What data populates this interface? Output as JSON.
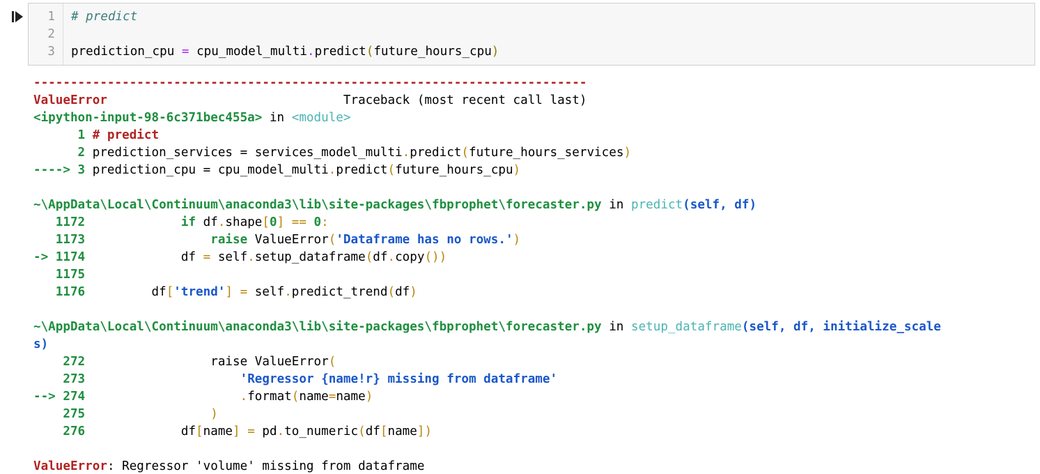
{
  "cell": {
    "line_numbers": [
      "1",
      "2",
      "3"
    ],
    "lines": {
      "l1_comment": "# predict",
      "l3_var": "prediction_cpu ",
      "l3_eq": "=",
      "l3_obj": " cpu_model_multi",
      "l3_dot": ".",
      "l3_func": "predict",
      "l3_open": "(",
      "l3_arg": "future_hours_cpu",
      "l3_close": ")"
    }
  },
  "output": {
    "dashes": "---------------------------------------------------------------------------",
    "error_name": "ValueError",
    "traceback_label": "                                Traceback (most recent call last)",
    "frame1": {
      "file": "<ipython-input-98-6c371bec455a>",
      "in": " in ",
      "func": "<module>",
      "l1_num": "      1 ",
      "l1_code": "# predict",
      "l2_num": "      2 ",
      "l2_pre": "prediction_services = services_model_multi",
      "l2_dot": ".",
      "l2_func": "predict",
      "l2_open": "(",
      "l2_arg": "future_hours_services",
      "l2_close": ")",
      "l3_arrow": "----> 3 ",
      "l3_pre": "prediction_cpu = cpu_model_multi",
      "l3_dot": ".",
      "l3_func": "predict",
      "l3_open": "(",
      "l3_arg": "future_hours_cpu",
      "l3_close": ")"
    },
    "frame2": {
      "file": "~\\AppData\\Local\\Continuum\\anaconda3\\lib\\site-packages\\fbprophet\\forecaster.py",
      "in": " in ",
      "func": "predict",
      "args": "(self, df)",
      "n1172": "   1172 ",
      "c1172_indent": "            ",
      "c1172_if": "if",
      "c1172_a": " df",
      "c1172_dot": ".",
      "c1172_b": "shape",
      "c1172_lb": "[",
      "c1172_zero": "0",
      "c1172_rb": "]",
      "c1172_c": " ",
      "c1172_eq": "==",
      "c1172_d": " ",
      "c1172_zero2": "0",
      "c1172_colon": ":",
      "n1173": "   1173 ",
      "c1173_indent": "                ",
      "c1173_raise": "raise",
      "c1173_a": " ValueError",
      "c1173_open": "(",
      "c1173_str": "'Dataframe has no rows.'",
      "c1173_close": ")",
      "n1174": "-> 1174 ",
      "c1174_indent": "            ",
      "c1174_a": "df ",
      "c1174_eq": "=",
      "c1174_b": " self",
      "c1174_dot": ".",
      "c1174_c": "setup_dataframe",
      "c1174_open": "(",
      "c1174_d": "df",
      "c1174_dot2": ".",
      "c1174_e": "copy",
      "c1174_parens": "())",
      "n1175": "   1175 ",
      "n1176": "   1176 ",
      "c1176_indent": "        ",
      "c1176_a": "df",
      "c1176_lb": "[",
      "c1176_str": "'trend'",
      "c1176_rb": "]",
      "c1176_b": " ",
      "c1176_eq": "=",
      "c1176_c": " self",
      "c1176_dot": ".",
      "c1176_d": "predict_trend",
      "c1176_open": "(",
      "c1176_e": "df",
      "c1176_close": ")"
    },
    "frame3": {
      "file": "~\\AppData\\Local\\Continuum\\anaconda3\\lib\\site-packages\\fbprophet\\forecaster.py",
      "in": " in ",
      "func": "setup_dataframe",
      "args_a": "(self, df, initialize_scale",
      "args_b": "s)",
      "n272": "    272 ",
      "c272_indent": "                ",
      "c272_a": "raise ValueError",
      "c272_open": "(",
      "n273": "    273 ",
      "c273_indent": "                    ",
      "c273_str": "'Regressor {name!r} missing from dataframe'",
      "n274": "--> 274 ",
      "c274_indent": "                    ",
      "c274_dot": ".",
      "c274_a": "format",
      "c274_open": "(",
      "c274_b": "name",
      "c274_eq": "=",
      "c274_c": "name",
      "c274_close": ")",
      "n275": "    275 ",
      "c275_indent": "                ",
      "c275_close": ")",
      "n276": "    276 ",
      "c276_indent": "            ",
      "c276_a": "df",
      "c276_lb": "[",
      "c276_b": "name",
      "c276_rb": "]",
      "c276_c": " ",
      "c276_eq": "=",
      "c276_d": " pd",
      "c276_dot": ".",
      "c276_e": "to_numeric",
      "c276_open": "(",
      "c276_f": "df",
      "c276_lb2": "[",
      "c276_g": "name",
      "c276_rb2": "])"
    },
    "final": {
      "error_name": "ValueError",
      "message": ": Regressor 'volume' missing from dataframe"
    }
  }
}
